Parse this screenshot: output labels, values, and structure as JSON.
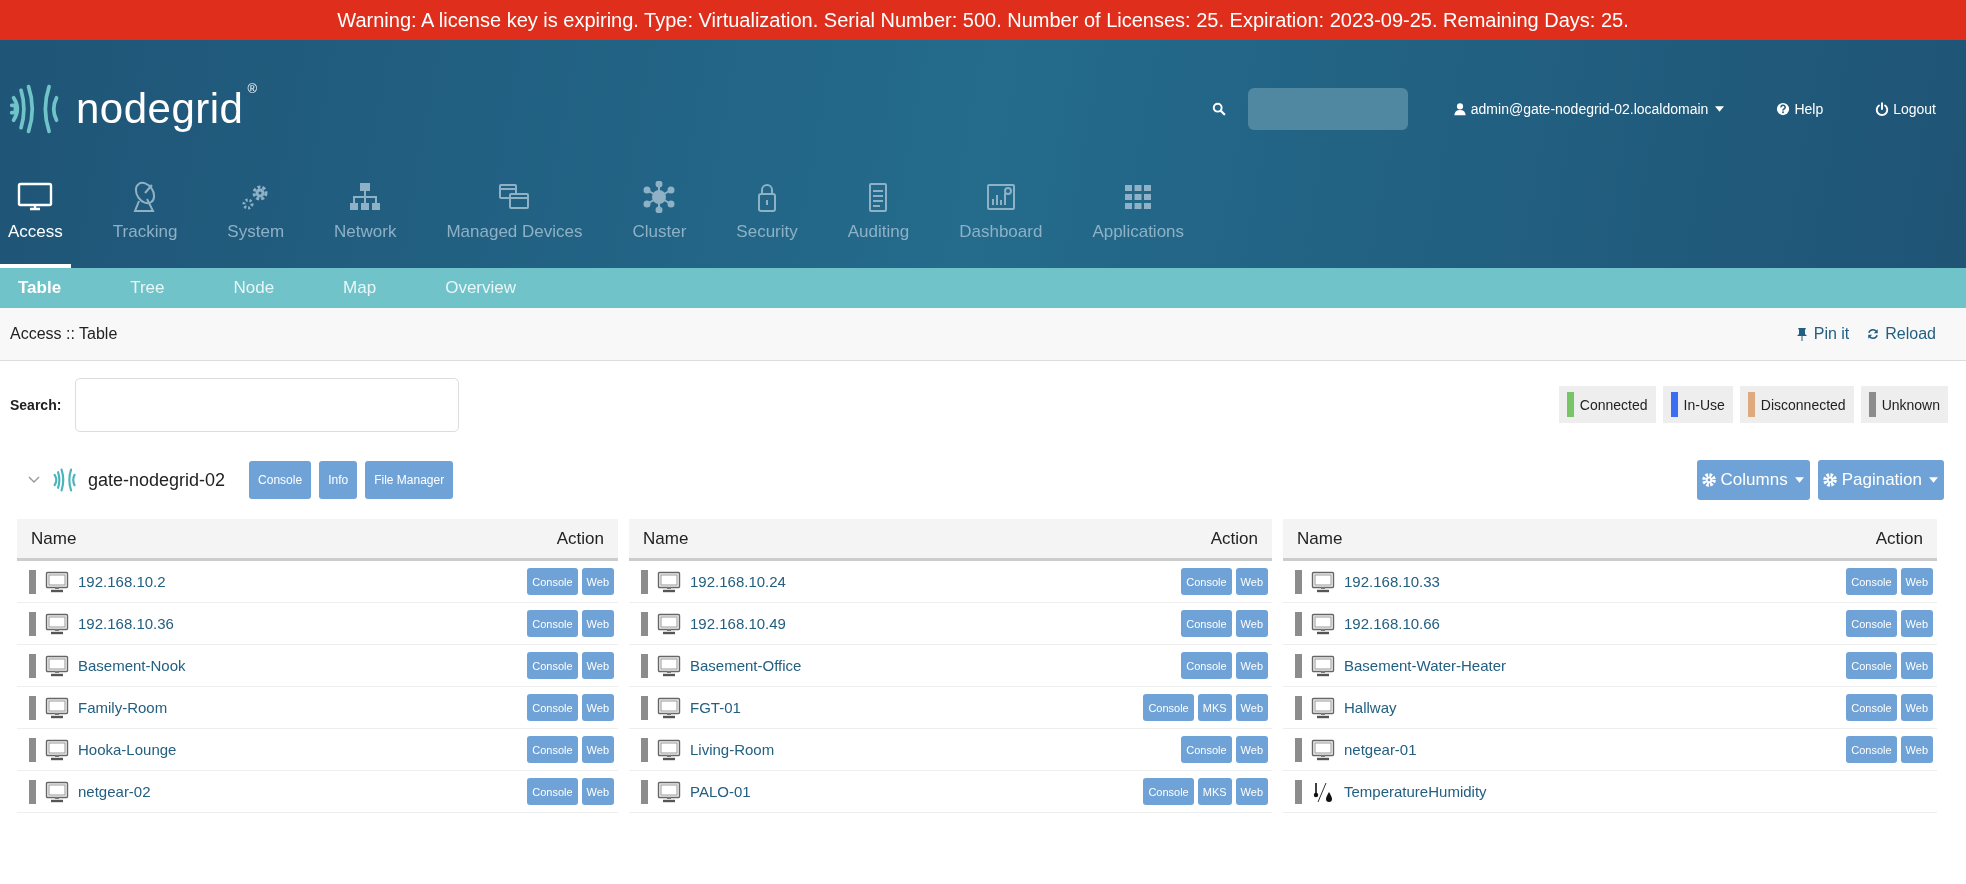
{
  "warning": "Warning: A license key is expiring. Type: Virtualization. Serial Number: 500. Number of Licenses: 25. Expiration: 2023-09-25. Remaining Days: 25.",
  "brand": {
    "name": "nodegrid",
    "mark": "®"
  },
  "user": "admin@gate-nodegrid-02.localdomain",
  "help": "Help",
  "logout": "Logout",
  "nav": [
    {
      "label": "Access",
      "selected": true
    },
    {
      "label": "Tracking",
      "selected": false
    },
    {
      "label": "System",
      "selected": false
    },
    {
      "label": "Network",
      "selected": false
    },
    {
      "label": "Managed Devices",
      "selected": false
    },
    {
      "label": "Cluster",
      "selected": false
    },
    {
      "label": "Security",
      "selected": false
    },
    {
      "label": "Auditing",
      "selected": false
    },
    {
      "label": "Dashboard",
      "selected": false
    },
    {
      "label": "Applications",
      "selected": false
    }
  ],
  "subtabs": [
    {
      "label": "Table",
      "selected": true
    },
    {
      "label": "Tree",
      "selected": false
    },
    {
      "label": "Node",
      "selected": false
    },
    {
      "label": "Map",
      "selected": false
    },
    {
      "label": "Overview",
      "selected": false
    }
  ],
  "breadcrumb": "Access :: Table",
  "pin": "Pin it",
  "reload": "Reload",
  "search_label": "Search:",
  "legend": [
    {
      "label": "Connected",
      "color": "#77c566"
    },
    {
      "label": "In-Use",
      "color": "#3a6ff5"
    },
    {
      "label": "Disconnected",
      "color": "#dfaa7e"
    },
    {
      "label": "Unknown",
      "color": "#8c8c8c"
    }
  ],
  "group": {
    "name": "gate-nodegrid-02",
    "expanded": true,
    "buttons": [
      "Console",
      "Info",
      "File Manager"
    ]
  },
  "columns_button": "Columns",
  "pagination_button": "Pagination",
  "tables": [
    {
      "headers": [
        "Name",
        "Action"
      ],
      "rows": [
        {
          "kind": "monitor",
          "name": "192.168.10.2",
          "color": "#8c8c8c",
          "actions": [
            "Console",
            "Web"
          ]
        },
        {
          "kind": "monitor",
          "name": "192.168.10.36",
          "color": "#8c8c8c",
          "actions": [
            "Console",
            "Web"
          ]
        },
        {
          "kind": "monitor",
          "name": "Basement-Nook",
          "color": "#8c8c8c",
          "actions": [
            "Console",
            "Web"
          ]
        },
        {
          "kind": "monitor",
          "name": "Family-Room",
          "color": "#8c8c8c",
          "actions": [
            "Console",
            "Web"
          ]
        },
        {
          "kind": "monitor",
          "name": "Hooka-Lounge",
          "color": "#8c8c8c",
          "actions": [
            "Console",
            "Web"
          ]
        },
        {
          "kind": "monitor",
          "name": "netgear-02",
          "color": "#8c8c8c",
          "actions": [
            "Console",
            "Web"
          ]
        }
      ]
    },
    {
      "headers": [
        "Name",
        "Action"
      ],
      "rows": [
        {
          "kind": "monitor",
          "name": "192.168.10.24",
          "color": "#8c8c8c",
          "actions": [
            "Console",
            "Web"
          ]
        },
        {
          "kind": "monitor",
          "name": "192.168.10.49",
          "color": "#8c8c8c",
          "actions": [
            "Console",
            "Web"
          ]
        },
        {
          "kind": "monitor",
          "name": "Basement-Office",
          "color": "#8c8c8c",
          "actions": [
            "Console",
            "Web"
          ]
        },
        {
          "kind": "monitor",
          "name": "FGT-01",
          "color": "#8c8c8c",
          "actions": [
            "Console",
            "MKS",
            "Web"
          ]
        },
        {
          "kind": "monitor",
          "name": "Living-Room",
          "color": "#8c8c8c",
          "actions": [
            "Console",
            "Web"
          ]
        },
        {
          "kind": "monitor",
          "name": "PALO-01",
          "color": "#8c8c8c",
          "actions": [
            "Console",
            "MKS",
            "Web"
          ]
        }
      ]
    },
    {
      "headers": [
        "Name",
        "Action"
      ],
      "rows": [
        {
          "kind": "monitor",
          "name": "192.168.10.33",
          "color": "#8c8c8c",
          "actions": [
            "Console",
            "Web"
          ]
        },
        {
          "kind": "monitor",
          "name": "192.168.10.66",
          "color": "#8c8c8c",
          "actions": [
            "Console",
            "Web"
          ]
        },
        {
          "kind": "monitor",
          "name": "Basement-Water-Heater",
          "color": "#8c8c8c",
          "actions": [
            "Console",
            "Web"
          ]
        },
        {
          "kind": "monitor",
          "name": "Hallway",
          "color": "#8c8c8c",
          "actions": [
            "Console",
            "Web"
          ]
        },
        {
          "kind": "monitor",
          "name": "netgear-01",
          "color": "#8c8c8c",
          "actions": [
            "Console",
            "Web"
          ]
        },
        {
          "kind": "sensor",
          "name": "TemperatureHumidity",
          "color": "#8c8c8c",
          "actions": []
        }
      ]
    }
  ]
}
